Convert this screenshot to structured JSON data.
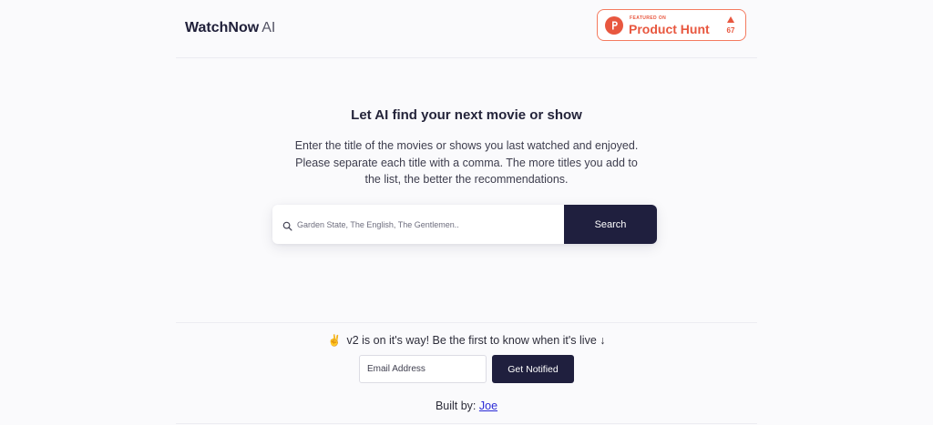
{
  "header": {
    "brand_name": "WatchNow",
    "brand_suffix": "AI",
    "product_hunt": {
      "featured_label": "FEATURED ON",
      "name": "Product Hunt",
      "upvotes": "67",
      "color": "#e8573f"
    }
  },
  "hero": {
    "title": "Let AI find your next movie or show",
    "description": "Enter the title of the movies or shows you last watched and enjoyed. Please separate each title with a comma. The more titles you add to the list, the better the recommendations."
  },
  "search": {
    "icon": "search-icon",
    "placeholder": "Garden State, The English, The Gentlemen..",
    "value": "",
    "button_label": "Search"
  },
  "footer": {
    "announcement_emoji": "✌️",
    "announcement_text": "v2 is on it's way! Be the first to know when it's live ↓",
    "email_placeholder": "Email Address",
    "notify_label": "Get Notified",
    "built_by_label": "Built by:",
    "built_by_name": "Joe"
  },
  "colors": {
    "background": "#fafafc",
    "primary_dark": "#1f1f3e",
    "accent": "#e8573f",
    "link": "#2a2ad6"
  }
}
